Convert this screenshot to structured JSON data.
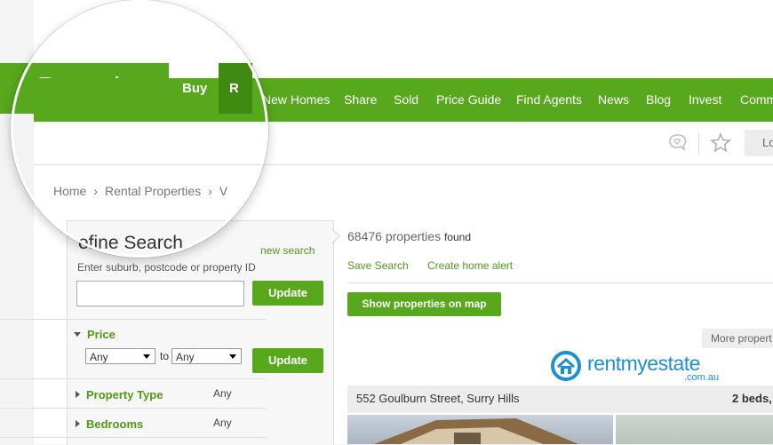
{
  "logo": "Domain",
  "nav": [
    {
      "label": "Buy",
      "left": 0
    },
    {
      "label": "R"
    },
    {
      "label": "New Homes"
    },
    {
      "label": "Share"
    },
    {
      "label": "Sold"
    },
    {
      "label": "Price Guide"
    },
    {
      "label": "Find Agents"
    },
    {
      "label": "News"
    },
    {
      "label": "Blog"
    },
    {
      "label": "Invest"
    },
    {
      "label": "Comm"
    }
  ],
  "subbar": {
    "login_label": "Lo"
  },
  "breadcrumb": [
    "Home",
    "Rental Properties",
    "V"
  ],
  "sidebar": {
    "title": "efine Search",
    "new_search": "new search",
    "search_hint": "Enter suburb, postcode or property ID",
    "search_value": "",
    "update_label": "Update",
    "price_label": "Price",
    "price_min": "Any",
    "price_to": "to",
    "price_max": "Any",
    "property_type_label": "Property Type",
    "property_type_value": "Any",
    "bedrooms_label": "Bedrooms",
    "bedrooms_value": "Any"
  },
  "results": {
    "count": "68476 properties",
    "found": "found",
    "save_search": "Save Search",
    "create_alert": "Create home alert",
    "map_button": "Show properties on map",
    "more_properties": "More propert",
    "brand_name": "rentmyestate",
    "brand_domain": ".com.au",
    "listing_address": "552 Goulburn Street, Surry Hills",
    "listing_beds": "2 beds,"
  },
  "colors": {
    "brand_green": "#57a81c",
    "active_green": "#3f8a10",
    "link_green": "#4f9a17",
    "rme_blue": "#1e8fd0"
  }
}
